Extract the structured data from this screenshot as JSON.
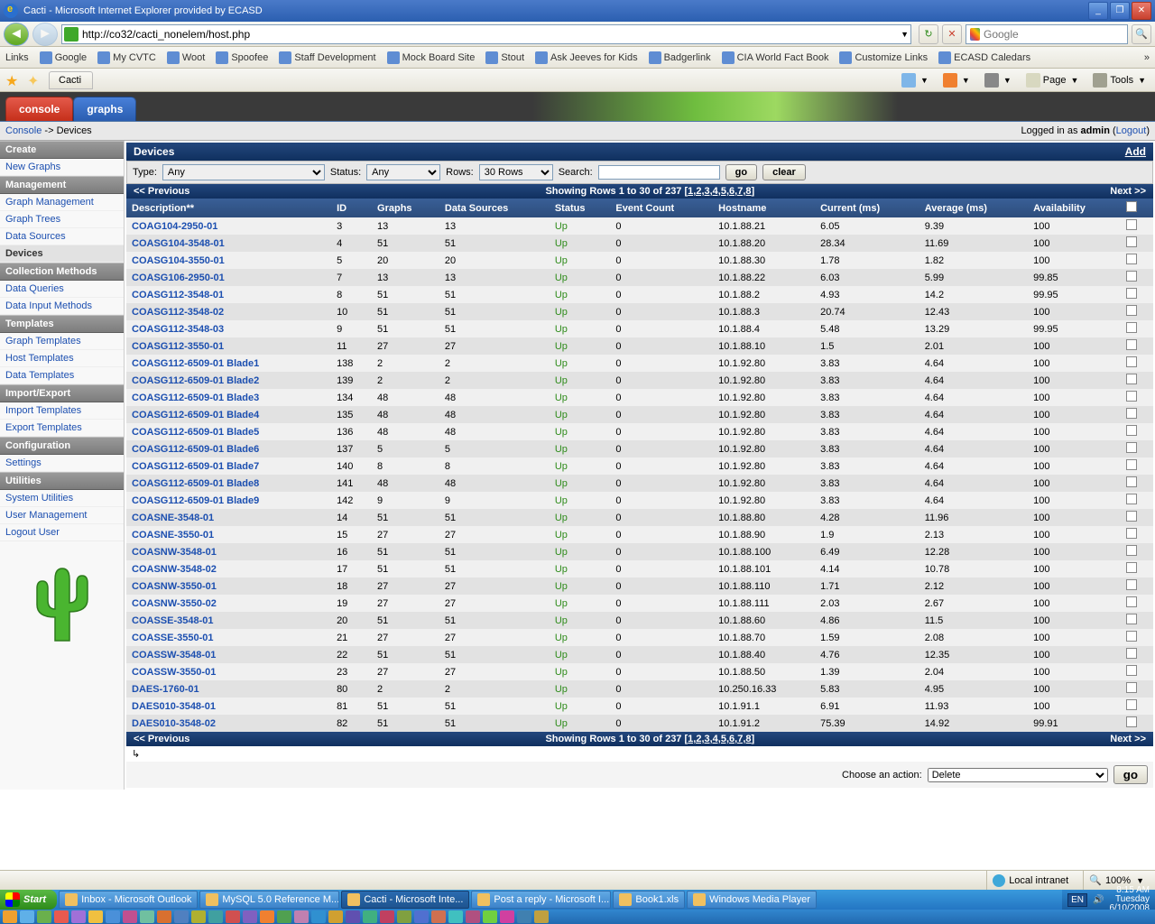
{
  "window": {
    "title": "Cacti - Microsoft Internet Explorer provided by ECASD",
    "url": "http://co32/cacti_nonelem/host.php"
  },
  "browser": {
    "search_placeholder": "Google",
    "links_label": "Links",
    "bookmarks": [
      "Google",
      "My CVTC",
      "Woot",
      "Spoofee",
      "Staff Development",
      "Mock Board Site",
      "Stout",
      "Ask Jeeves for Kids",
      "Badgerlink",
      "CIA World Fact Book",
      "Customize Links",
      "ECASD Caledars"
    ],
    "tab_title": "Cacti",
    "tool_home": "",
    "tool_page": "Page",
    "tool_tools": "Tools"
  },
  "cacti_tabs": {
    "console": "console",
    "graphs": "graphs"
  },
  "breadcrumb": {
    "root": "Console",
    "sep": " -> ",
    "current": "Devices",
    "logged_in": "Logged in as ",
    "user": "admin",
    "logout": "Logout"
  },
  "sidebar": [
    {
      "type": "hdr",
      "label": "Create"
    },
    {
      "type": "item",
      "label": "New Graphs"
    },
    {
      "type": "hdr",
      "label": "Management"
    },
    {
      "type": "item",
      "label": "Graph Management"
    },
    {
      "type": "item",
      "label": "Graph Trees"
    },
    {
      "type": "item",
      "label": "Data Sources"
    },
    {
      "type": "item",
      "label": "Devices",
      "active": true
    },
    {
      "type": "hdr",
      "label": "Collection Methods"
    },
    {
      "type": "item",
      "label": "Data Queries"
    },
    {
      "type": "item",
      "label": "Data Input Methods"
    },
    {
      "type": "hdr",
      "label": "Templates"
    },
    {
      "type": "item",
      "label": "Graph Templates"
    },
    {
      "type": "item",
      "label": "Host Templates"
    },
    {
      "type": "item",
      "label": "Data Templates"
    },
    {
      "type": "hdr",
      "label": "Import/Export"
    },
    {
      "type": "item",
      "label": "Import Templates"
    },
    {
      "type": "item",
      "label": "Export Templates"
    },
    {
      "type": "hdr",
      "label": "Configuration"
    },
    {
      "type": "item",
      "label": "Settings"
    },
    {
      "type": "hdr",
      "label": "Utilities"
    },
    {
      "type": "item",
      "label": "System Utilities"
    },
    {
      "type": "item",
      "label": "User Management"
    },
    {
      "type": "item",
      "label": "Logout User"
    }
  ],
  "panel": {
    "title": "Devices",
    "add": "Add"
  },
  "filter": {
    "type_label": "Type:",
    "type_value": "Any",
    "status_label": "Status:",
    "status_value": "Any",
    "rows_label": "Rows:",
    "rows_value": "30 Rows",
    "search_label": "Search:",
    "search_value": "",
    "go": "go",
    "clear": "clear"
  },
  "pager": {
    "prev": "<< Previous",
    "showing": "Showing Rows 1 to 30 of 237 [",
    "pages": "1,2,3,4,5,6,7,8",
    "close": "]",
    "next": "Next >>"
  },
  "columns": [
    "Description**",
    "ID",
    "Graphs",
    "Data Sources",
    "Status",
    "Event Count",
    "Hostname",
    "Current (ms)",
    "Average (ms)",
    "Availability"
  ],
  "rows": [
    {
      "desc": "COAG104-2950-01",
      "id": "3",
      "g": "13",
      "ds": "13",
      "st": "Up",
      "ev": "0",
      "host": "10.1.88.21",
      "cur": "6.05",
      "avg": "9.39",
      "av": "100"
    },
    {
      "desc": "COASG104-3548-01",
      "id": "4",
      "g": "51",
      "ds": "51",
      "st": "Up",
      "ev": "0",
      "host": "10.1.88.20",
      "cur": "28.34",
      "avg": "11.69",
      "av": "100"
    },
    {
      "desc": "COASG104-3550-01",
      "id": "5",
      "g": "20",
      "ds": "20",
      "st": "Up",
      "ev": "0",
      "host": "10.1.88.30",
      "cur": "1.78",
      "avg": "1.82",
      "av": "100"
    },
    {
      "desc": "COASG106-2950-01",
      "id": "7",
      "g": "13",
      "ds": "13",
      "st": "Up",
      "ev": "0",
      "host": "10.1.88.22",
      "cur": "6.03",
      "avg": "5.99",
      "av": "99.85"
    },
    {
      "desc": "COASG112-3548-01",
      "id": "8",
      "g": "51",
      "ds": "51",
      "st": "Up",
      "ev": "0",
      "host": "10.1.88.2",
      "cur": "4.93",
      "avg": "14.2",
      "av": "99.95"
    },
    {
      "desc": "COASG112-3548-02",
      "id": "10",
      "g": "51",
      "ds": "51",
      "st": "Up",
      "ev": "0",
      "host": "10.1.88.3",
      "cur": "20.74",
      "avg": "12.43",
      "av": "100"
    },
    {
      "desc": "COASG112-3548-03",
      "id": "9",
      "g": "51",
      "ds": "51",
      "st": "Up",
      "ev": "0",
      "host": "10.1.88.4",
      "cur": "5.48",
      "avg": "13.29",
      "av": "99.95"
    },
    {
      "desc": "COASG112-3550-01",
      "id": "11",
      "g": "27",
      "ds": "27",
      "st": "Up",
      "ev": "0",
      "host": "10.1.88.10",
      "cur": "1.5",
      "avg": "2.01",
      "av": "100"
    },
    {
      "desc": "COASG112-6509-01 Blade1",
      "id": "138",
      "g": "2",
      "ds": "2",
      "st": "Up",
      "ev": "0",
      "host": "10.1.92.80",
      "cur": "3.83",
      "avg": "4.64",
      "av": "100"
    },
    {
      "desc": "COASG112-6509-01 Blade2",
      "id": "139",
      "g": "2",
      "ds": "2",
      "st": "Up",
      "ev": "0",
      "host": "10.1.92.80",
      "cur": "3.83",
      "avg": "4.64",
      "av": "100"
    },
    {
      "desc": "COASG112-6509-01 Blade3",
      "id": "134",
      "g": "48",
      "ds": "48",
      "st": "Up",
      "ev": "0",
      "host": "10.1.92.80",
      "cur": "3.83",
      "avg": "4.64",
      "av": "100"
    },
    {
      "desc": "COASG112-6509-01 Blade4",
      "id": "135",
      "g": "48",
      "ds": "48",
      "st": "Up",
      "ev": "0",
      "host": "10.1.92.80",
      "cur": "3.83",
      "avg": "4.64",
      "av": "100"
    },
    {
      "desc": "COASG112-6509-01 Blade5",
      "id": "136",
      "g": "48",
      "ds": "48",
      "st": "Up",
      "ev": "0",
      "host": "10.1.92.80",
      "cur": "3.83",
      "avg": "4.64",
      "av": "100"
    },
    {
      "desc": "COASG112-6509-01 Blade6",
      "id": "137",
      "g": "5",
      "ds": "5",
      "st": "Up",
      "ev": "0",
      "host": "10.1.92.80",
      "cur": "3.83",
      "avg": "4.64",
      "av": "100"
    },
    {
      "desc": "COASG112-6509-01 Blade7",
      "id": "140",
      "g": "8",
      "ds": "8",
      "st": "Up",
      "ev": "0",
      "host": "10.1.92.80",
      "cur": "3.83",
      "avg": "4.64",
      "av": "100"
    },
    {
      "desc": "COASG112-6509-01 Blade8",
      "id": "141",
      "g": "48",
      "ds": "48",
      "st": "Up",
      "ev": "0",
      "host": "10.1.92.80",
      "cur": "3.83",
      "avg": "4.64",
      "av": "100"
    },
    {
      "desc": "COASG112-6509-01 Blade9",
      "id": "142",
      "g": "9",
      "ds": "9",
      "st": "Up",
      "ev": "0",
      "host": "10.1.92.80",
      "cur": "3.83",
      "avg": "4.64",
      "av": "100"
    },
    {
      "desc": "COASNE-3548-01",
      "id": "14",
      "g": "51",
      "ds": "51",
      "st": "Up",
      "ev": "0",
      "host": "10.1.88.80",
      "cur": "4.28",
      "avg": "11.96",
      "av": "100"
    },
    {
      "desc": "COASNE-3550-01",
      "id": "15",
      "g": "27",
      "ds": "27",
      "st": "Up",
      "ev": "0",
      "host": "10.1.88.90",
      "cur": "1.9",
      "avg": "2.13",
      "av": "100"
    },
    {
      "desc": "COASNW-3548-01",
      "id": "16",
      "g": "51",
      "ds": "51",
      "st": "Up",
      "ev": "0",
      "host": "10.1.88.100",
      "cur": "6.49",
      "avg": "12.28",
      "av": "100"
    },
    {
      "desc": "COASNW-3548-02",
      "id": "17",
      "g": "51",
      "ds": "51",
      "st": "Up",
      "ev": "0",
      "host": "10.1.88.101",
      "cur": "4.14",
      "avg": "10.78",
      "av": "100"
    },
    {
      "desc": "COASNW-3550-01",
      "id": "18",
      "g": "27",
      "ds": "27",
      "st": "Up",
      "ev": "0",
      "host": "10.1.88.110",
      "cur": "1.71",
      "avg": "2.12",
      "av": "100"
    },
    {
      "desc": "COASNW-3550-02",
      "id": "19",
      "g": "27",
      "ds": "27",
      "st": "Up",
      "ev": "0",
      "host": "10.1.88.111",
      "cur": "2.03",
      "avg": "2.67",
      "av": "100"
    },
    {
      "desc": "COASSE-3548-01",
      "id": "20",
      "g": "51",
      "ds": "51",
      "st": "Up",
      "ev": "0",
      "host": "10.1.88.60",
      "cur": "4.86",
      "avg": "11.5",
      "av": "100"
    },
    {
      "desc": "COASSE-3550-01",
      "id": "21",
      "g": "27",
      "ds": "27",
      "st": "Up",
      "ev": "0",
      "host": "10.1.88.70",
      "cur": "1.59",
      "avg": "2.08",
      "av": "100"
    },
    {
      "desc": "COASSW-3548-01",
      "id": "22",
      "g": "51",
      "ds": "51",
      "st": "Up",
      "ev": "0",
      "host": "10.1.88.40",
      "cur": "4.76",
      "avg": "12.35",
      "av": "100"
    },
    {
      "desc": "COASSW-3550-01",
      "id": "23",
      "g": "27",
      "ds": "27",
      "st": "Up",
      "ev": "0",
      "host": "10.1.88.50",
      "cur": "1.39",
      "avg": "2.04",
      "av": "100"
    },
    {
      "desc": "DAES-1760-01",
      "id": "80",
      "g": "2",
      "ds": "2",
      "st": "Up",
      "ev": "0",
      "host": "10.250.16.33",
      "cur": "5.83",
      "avg": "4.95",
      "av": "100"
    },
    {
      "desc": "DAES010-3548-01",
      "id": "81",
      "g": "51",
      "ds": "51",
      "st": "Up",
      "ev": "0",
      "host": "10.1.91.1",
      "cur": "6.91",
      "avg": "11.93",
      "av": "100"
    },
    {
      "desc": "DAES010-3548-02",
      "id": "82",
      "g": "51",
      "ds": "51",
      "st": "Up",
      "ev": "0",
      "host": "10.1.91.2",
      "cur": "75.39",
      "avg": "14.92",
      "av": "99.91"
    }
  ],
  "action": {
    "label": "Choose an action:",
    "value": "Delete",
    "go": "go"
  },
  "corner": "↳",
  "statusbar": {
    "zone": "Local intranet",
    "zoom": "100%"
  },
  "taskbar": {
    "start": "Start",
    "items": [
      {
        "label": "Inbox - Microsoft Outlook"
      },
      {
        "label": "MySQL 5.0 Reference M..."
      },
      {
        "label": "Cacti - Microsoft Inte...",
        "active": true
      },
      {
        "label": "Post a reply - Microsoft I..."
      },
      {
        "label": "Book1.xls"
      },
      {
        "label": "Windows Media Player"
      }
    ],
    "time": "8:15 AM",
    "day": "Tuesday",
    "date": "6/10/2008",
    "lang": "EN"
  }
}
